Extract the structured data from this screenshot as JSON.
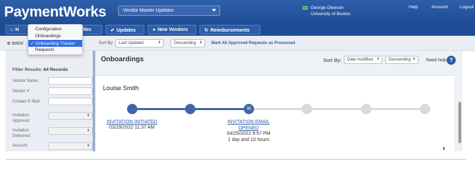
{
  "header": {
    "logo": "PaymentWorks",
    "vendor_select": "Vendor Master Updates",
    "user_name": "George Gleeson",
    "user_org": "University of Boston",
    "links": [
      "Help",
      "Account",
      "Logout"
    ]
  },
  "nav": {
    "home_label": "H",
    "profiles_label": "rofiles",
    "updates_label": "Updates",
    "new_vendors_label": "New Vendors",
    "reimbursements_label": "Reimbursements"
  },
  "dropdown_menu": {
    "items": [
      "Configuration",
      "Onboardings",
      "Onboarding Tracker",
      "Requests"
    ],
    "selected_index": 2
  },
  "toolbar": {
    "show_label": "SHOV",
    "sort_by_label": "Sort By:",
    "sort_field": "Last Updated",
    "sort_order": "Descending",
    "mark_link": "Mark All Approved Requests as Processed"
  },
  "filters": {
    "results_prefix": "Filter Results:",
    "results_count": "64 Records",
    "vendor_name_label": "Vendor Name:",
    "vendor_num_label": "Vendor #:",
    "contact_email_label": "Contact E-Mail:",
    "invitation_approval_label": "Invitation Approval:",
    "invitation_delivered_label": "Invitation Delivered:",
    "account_label": "Account"
  },
  "main": {
    "title": "Onboardings",
    "sort_by_label": "Sort By:",
    "sort_field": "Date modified",
    "sort_order": "Descending",
    "need_help": "Need help",
    "help_icon_glyph": "?"
  },
  "card": {
    "name": "Louise Smith",
    "steps": [
      {
        "title": "INVITATION INITIATED",
        "date": "03/29/2022 11:37 AM"
      },
      {
        "title_line1": "INVITATION EMAIL",
        "title_line2": "OPENED",
        "date": "04/25/2022 9:57 PM",
        "duration": "1 day and 10 hours"
      }
    ],
    "next_glyph": "›"
  }
}
